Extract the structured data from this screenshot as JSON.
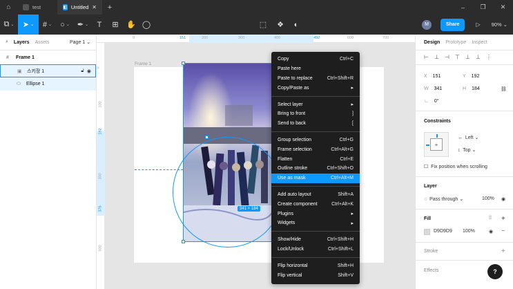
{
  "titlebar": {
    "tabs": [
      {
        "label": "test",
        "active": false
      },
      {
        "label": "Untitled",
        "active": true
      }
    ]
  },
  "toolbar": {
    "avatar_initial": "M",
    "share_label": "Share",
    "zoom": "90%"
  },
  "layers_panel": {
    "tab_layers": "Layers",
    "tab_assets": "Assets",
    "page": "Page 1",
    "items": [
      {
        "label": "Frame 1",
        "type": "frame"
      },
      {
        "label": "스키장 1",
        "type": "image"
      },
      {
        "label": "Ellipse 1",
        "type": "ellipse"
      }
    ]
  },
  "canvas": {
    "frame_label": "Frame 1",
    "ruler_top": [
      "0",
      "151",
      "200",
      "300",
      "400",
      "492",
      "600",
      "700"
    ],
    "ruler_left": [
      "0",
      "100",
      "192",
      "300",
      "376",
      "500"
    ],
    "size_badge": "341 × 184"
  },
  "context_menu": [
    {
      "label": "Copy",
      "shortcut": "Ctrl+C"
    },
    {
      "label": "Paste here",
      "shortcut": ""
    },
    {
      "label": "Paste to replace",
      "shortcut": "Ctrl+Shift+R"
    },
    {
      "label": "Copy/Paste as",
      "shortcut": "▸"
    },
    {
      "sep": true
    },
    {
      "label": "Select layer",
      "shortcut": "▸"
    },
    {
      "label": "Bring to front",
      "shortcut": "]"
    },
    {
      "label": "Send to back",
      "shortcut": "["
    },
    {
      "sep": true
    },
    {
      "label": "Group selection",
      "shortcut": "Ctrl+G"
    },
    {
      "label": "Frame selection",
      "shortcut": "Ctrl+Alt+G"
    },
    {
      "label": "Flatten",
      "shortcut": "Ctrl+E"
    },
    {
      "label": "Outline stroke",
      "shortcut": "Ctrl+Shift+O"
    },
    {
      "label": "Use as mask",
      "shortcut": "Ctrl+Alt+M",
      "highlighted": true
    },
    {
      "sep": true
    },
    {
      "label": "Add auto layout",
      "shortcut": "Shift+A"
    },
    {
      "label": "Create component",
      "shortcut": "Ctrl+Alt+K"
    },
    {
      "label": "Plugins",
      "shortcut": "▸"
    },
    {
      "label": "Widgets",
      "shortcut": "▸"
    },
    {
      "sep": true
    },
    {
      "label": "Show/Hide",
      "shortcut": "Ctrl+Shift+H"
    },
    {
      "label": "Lock/Unlock",
      "shortcut": "Ctrl+Shift+L"
    },
    {
      "sep": true
    },
    {
      "label": "Flip horizontal",
      "shortcut": "Shift+H"
    },
    {
      "label": "Flip vertical",
      "shortcut": "Shift+V"
    }
  ],
  "props_panel": {
    "tab_design": "Design",
    "tab_prototype": "Prototype",
    "tab_inspect": "Inspect",
    "x_label": "X",
    "x": "151",
    "y_label": "Y",
    "y": "192",
    "w_label": "W",
    "w": "341",
    "h_label": "H",
    "h": "184",
    "rotation": "0°",
    "constraints_title": "Constraints",
    "constraint_h": "Left",
    "constraint_v": "Top",
    "fix_position": "Fix position when scrolling",
    "layer_title": "Layer",
    "blend": "Pass through",
    "layer_opacity": "100%",
    "fill_title": "Fill",
    "fill_hex": "D9D9D9",
    "fill_opacity": "100%",
    "stroke_title": "Stroke",
    "effects_title": "Effects",
    "help": "?"
  },
  "colors": {
    "accent": "#0d99ff",
    "toolbar_bg": "#2c2c2c",
    "menu_bg": "#1e1e1e",
    "fill": "#d9d9d9"
  }
}
